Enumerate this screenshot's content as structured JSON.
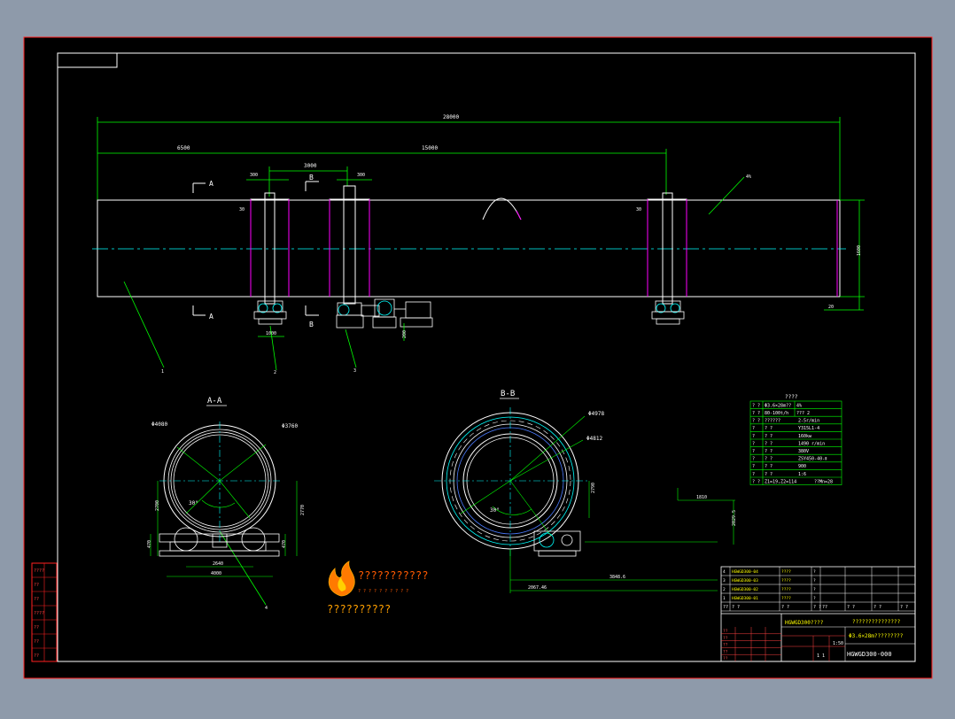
{
  "colors": {
    "background": "#8e9aaa",
    "sheet": "#000000",
    "frame": "#ff0000",
    "line": "#ffffff",
    "dim": "#00ff00",
    "accent": "#00ffff",
    "text_yellow": "#ffff00",
    "magenta": "#ff00ff",
    "blue": "#4b7bff",
    "orange": "#ff8c00"
  },
  "dimensions": {
    "overall": "28000",
    "left_end": "6500",
    "span": "15000",
    "tyre_gap": "3000",
    "tyre_w1": "300",
    "tyre_w2": "300",
    "tyre_h_left": "30",
    "tyre_h_right": "30",
    "diameter": "1600",
    "bottom_off": "20",
    "base_w": "1000",
    "drive_h": "200",
    "slope": "4%"
  },
  "section_marks": {
    "a": "A",
    "b": "B"
  },
  "leaders": {
    "l1": "1",
    "l2": "2",
    "l3": "3",
    "l4": "4",
    "l5": "4%"
  },
  "views": {
    "aa": {
      "title": "A-A",
      "d_outer": "Φ4080",
      "d_inner": "Φ3760",
      "angle": "30°",
      "height_left": "2700",
      "height_right": "2770",
      "side_left": "470",
      "side_right": "470",
      "width_1": "2640",
      "width_2": "4000"
    },
    "bb": {
      "title": "B-B",
      "d_outer": "Φ4978",
      "d_inner": "Φ4812",
      "angle": "30°",
      "dim_h": "2790",
      "dim_right": "2029.5",
      "dim_top": "1810",
      "dim_b1": "2067.46",
      "dim_b2": "3848.6"
    }
  },
  "logo": {
    "caption_1": "???????????",
    "caption_2": "?  ?  ?  ?  ?  ?  ?  ?  ?  ?",
    "caption_3": "??????????"
  },
  "spec_table": {
    "title": "????",
    "rows": [
      [
        "? ?",
        "Φ3.6×28m??",
        "4%"
      ],
      [
        "? ?",
        "80-100t/h",
        "???  2"
      ],
      [
        "? ?",
        "??????",
        "2-5r/min"
      ],
      [
        "?",
        "? ?",
        "Y315L1-4"
      ],
      [
        "?",
        "? ?",
        "160kw"
      ],
      [
        "?",
        "? ?",
        "1490 r/min"
      ],
      [
        "?",
        "? ?",
        "380V"
      ],
      [
        "?",
        "? ?",
        "ZSY450-40-Ⅱ"
      ],
      [
        "?",
        "? ?",
        "900"
      ],
      [
        "?",
        "? ?",
        "1:6"
      ],
      [
        "? ?",
        "Z1=19,Z2=114",
        "??Mn=28"
      ]
    ]
  },
  "title_block": {
    "parts": [
      [
        "4",
        "HGWGD300-04",
        "????",
        "?"
      ],
      [
        "3",
        "HGWGD300-03",
        "????",
        "?"
      ],
      [
        "2",
        "HGWGD300-02",
        "????",
        "?"
      ],
      [
        "1",
        "HGWGD300-01",
        "????",
        "?"
      ]
    ],
    "header": [
      "??",
      "?  ?",
      "?  ?",
      "?  ?",
      "??",
      "?  ?",
      "?  ?",
      "?  ?"
    ],
    "company": "???????????????",
    "product": "HGWGD300????",
    "drawing_name": "Φ3.6×28m?????????",
    "drawing_no": "HGWGD300-000",
    "scale": "1:50",
    "sheet": "1  1",
    "sign_rows": [
      "??",
      "??",
      "??",
      "??",
      "??"
    ]
  },
  "left_strip": [
    "????",
    "??",
    "??",
    "????",
    "??",
    "??",
    "??"
  ]
}
